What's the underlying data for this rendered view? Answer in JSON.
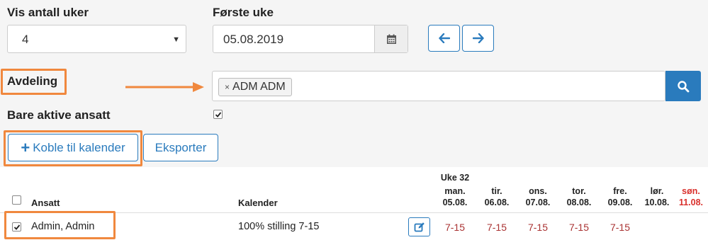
{
  "filters": {
    "weeks_label": "Vis antall uker",
    "weeks_value": "4",
    "first_week_label": "Første uke",
    "first_week_value": "05.08.2019",
    "department_label": "Avdeling",
    "department_tag": "ADM ADM",
    "active_label": "Bare aktive ansatt",
    "active_checked": true
  },
  "actions": {
    "connect_label": "Koble til kalender",
    "export_label": "Eksporter"
  },
  "table": {
    "week_label": "Uke 32",
    "col_employee": "Ansatt",
    "col_calendar": "Kalender",
    "days": [
      {
        "name": "man.",
        "date": "05.08.",
        "weekend": false
      },
      {
        "name": "tir.",
        "date": "06.08.",
        "weekend": false
      },
      {
        "name": "ons.",
        "date": "07.08.",
        "weekend": false
      },
      {
        "name": "tor.",
        "date": "08.08.",
        "weekend": false
      },
      {
        "name": "fre.",
        "date": "09.08.",
        "weekend": false
      },
      {
        "name": "lør.",
        "date": "10.08.",
        "weekend": false
      },
      {
        "name": "søn.",
        "date": "11.08.",
        "weekend": true
      }
    ],
    "rows": [
      {
        "employee": "Admin, Admin",
        "calendar": "100% stilling 7-15",
        "shifts": [
          "7-15",
          "7-15",
          "7-15",
          "7-15",
          "7-15",
          "",
          ""
        ]
      }
    ]
  },
  "colors": {
    "accent": "#2a7bbd",
    "highlight": "#f0883e",
    "weekend": "#d9302c",
    "shift": "#a33333"
  }
}
